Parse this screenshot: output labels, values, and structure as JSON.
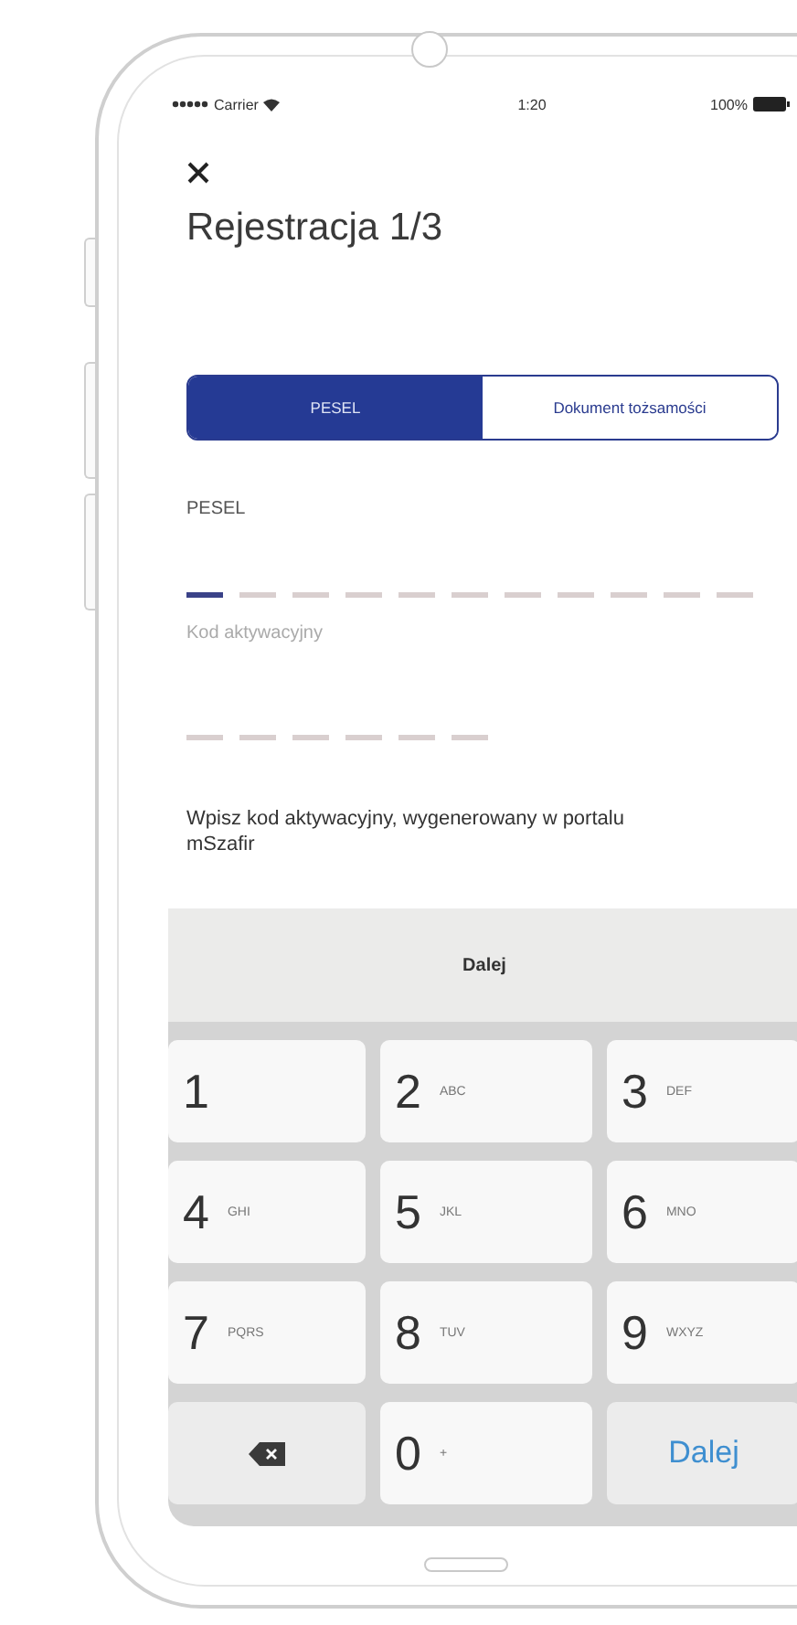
{
  "status_bar": {
    "carrier": "Carrier",
    "time": "1:20",
    "battery": "100%"
  },
  "title": "Rejestracja 1/3",
  "segments": [
    {
      "label": "PESEL",
      "selected": true
    },
    {
      "label": "Dokument tożsamości",
      "selected": false
    }
  ],
  "pesel_field": {
    "label": "PESEL",
    "slots": [
      {
        "active": true
      },
      {
        "active": false
      },
      {
        "active": false
      },
      {
        "active": false
      },
      {
        "active": false
      },
      {
        "active": false
      },
      {
        "active": false
      },
      {
        "active": false
      },
      {
        "active": false
      },
      {
        "active": false
      },
      {
        "active": false
      }
    ]
  },
  "code_field": {
    "label": "Kod aktywacyjny",
    "slots": [
      {
        "active": false
      },
      {
        "active": false
      },
      {
        "active": false
      },
      {
        "active": false
      },
      {
        "active": false
      },
      {
        "active": false
      }
    ]
  },
  "hint": "Wpisz kod aktywacyjny, wygenerowany w portalu mSzafir",
  "toolbar_button": "Dalej",
  "keypad": [
    {
      "kind": "digit",
      "digit": "1"
    },
    {
      "kind": "digit",
      "digit": "2",
      "letters": "ABC"
    },
    {
      "kind": "digit",
      "digit": "3",
      "letters": "DEF"
    },
    {
      "kind": "digit",
      "digit": "4",
      "letters": "GHI"
    },
    {
      "kind": "digit",
      "digit": "5",
      "letters": "JKL"
    },
    {
      "kind": "digit",
      "digit": "6",
      "letters": "MNO"
    },
    {
      "kind": "digit",
      "digit": "7",
      "letters": "PQRS"
    },
    {
      "kind": "digit",
      "digit": "8",
      "letters": "TUV"
    },
    {
      "kind": "digit",
      "digit": "9",
      "letters": "WXYZ"
    },
    {
      "kind": "delete"
    },
    {
      "kind": "digit",
      "digit": "0",
      "letters": "+"
    },
    {
      "kind": "action",
      "label": "Dalej"
    }
  ]
}
